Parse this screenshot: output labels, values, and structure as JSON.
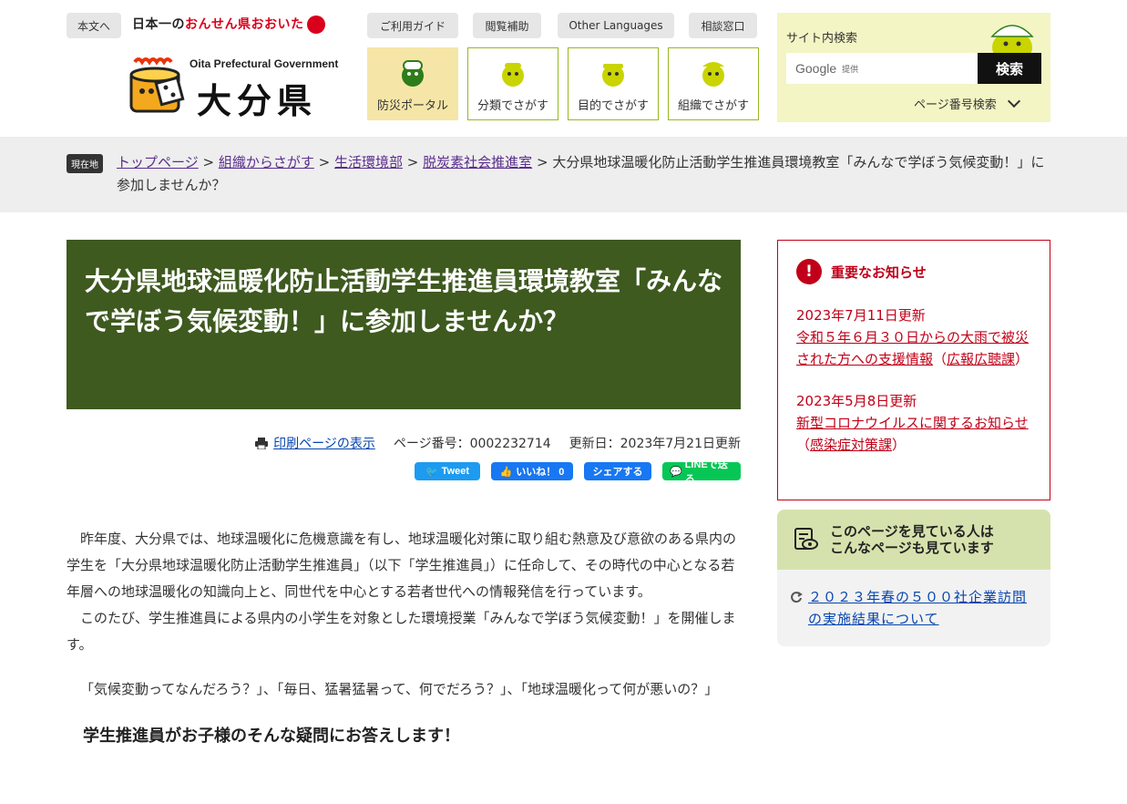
{
  "header": {
    "skip_label": "本文へ",
    "tagline_prefix": "日本一の",
    "tagline_onsen": "おんせん県おおいた",
    "logo_en": "Oita Prefectural Government",
    "logo_ja": "大分県",
    "util": [
      "ご利用ガイド",
      "閲覧補助",
      "Other Languages",
      "相談窓口"
    ],
    "nav_tiles": [
      {
        "label": "防災ポータル",
        "active": true
      },
      {
        "label": "分類でさがす",
        "active": false
      },
      {
        "label": "目的でさがす",
        "active": false
      },
      {
        "label": "組織でさがす",
        "active": false
      }
    ],
    "search": {
      "title": "サイト内検索",
      "google_label": "Google",
      "google_sub": "提供",
      "button": "検索",
      "page_number_search": "ページ番号検索"
    }
  },
  "breadcrumb": {
    "tag": "現在地",
    "items": [
      "トップページ",
      "組織からさがす",
      "生活環境部",
      "脱炭素社会推進室"
    ],
    "separator": ">",
    "current": "大分県地球温暖化防止活動学生推進員環境教室「みんなで学ぼう気候変動！」に参加しませんか？"
  },
  "article": {
    "title": "大分県地球温暖化防止活動学生推進員環境教室「みんなで学ぼう気候変動！」に参加しませんか？",
    "print_label": "印刷ページの表示",
    "page_number": "ページ番号：0002232714",
    "updated": "更新日：2023年7月21日更新",
    "share": [
      {
        "label": "Tweet",
        "color": "#1d9bf0"
      },
      {
        "label": "いいね！ 0",
        "color": "#1877f2"
      },
      {
        "label": "シェアする",
        "color": "#1877f2"
      },
      {
        "label": "LINEで送る",
        "color": "#06c755"
      }
    ],
    "paragraphs": [
      "昨年度、大分県では、地球温暖化に危機意識を有し、地球温暖化対策に取り組む熱意及び意欲のある県内の学生を「大分県地球温暖化防止活動学生推進員」（以下「学生推進員」）に任命して、その時代の中心となる若年層への地球温暖化の知識向上と、同世代を中心とする若者世代への情報発信を行っています。",
      "このたび、学生推進員による県内の小学生を対象とした環境授業「みんなで学ぼう気候変動！」を開催します。"
    ],
    "questions": "「気候変動ってなんだろう？」、「毎日、猛暑猛暑って、何でだろう？」、「地球温暖化って何が悪いの？」",
    "subheading": "学生推進員がお子様のそんな疑問にお答えします！"
  },
  "sidebar": {
    "notice_title": "重要なお知らせ",
    "notices": [
      {
        "date": "2023年7月11日更新",
        "link": "令和５年６月３０日からの大雨で被災された方への支援情報",
        "dept": "広報広聴課"
      },
      {
        "date": "2023年5月8日更新",
        "link": "新型コロナウイルスに関するお知らせ",
        "dept": "感染症対策課"
      }
    ],
    "also_title_line1": "このページを見ている人は",
    "also_title_line2": "こんなページも見ています",
    "also_link": "２０２３年春の５００社企業訪問の実施結果について"
  },
  "colors": {
    "title_bg": "#3e5a1f",
    "notice_red": "#c00018",
    "search_bg": "#f3f5c4",
    "tile_border": "#97b81f",
    "tile_active": "#f5e6a8"
  }
}
